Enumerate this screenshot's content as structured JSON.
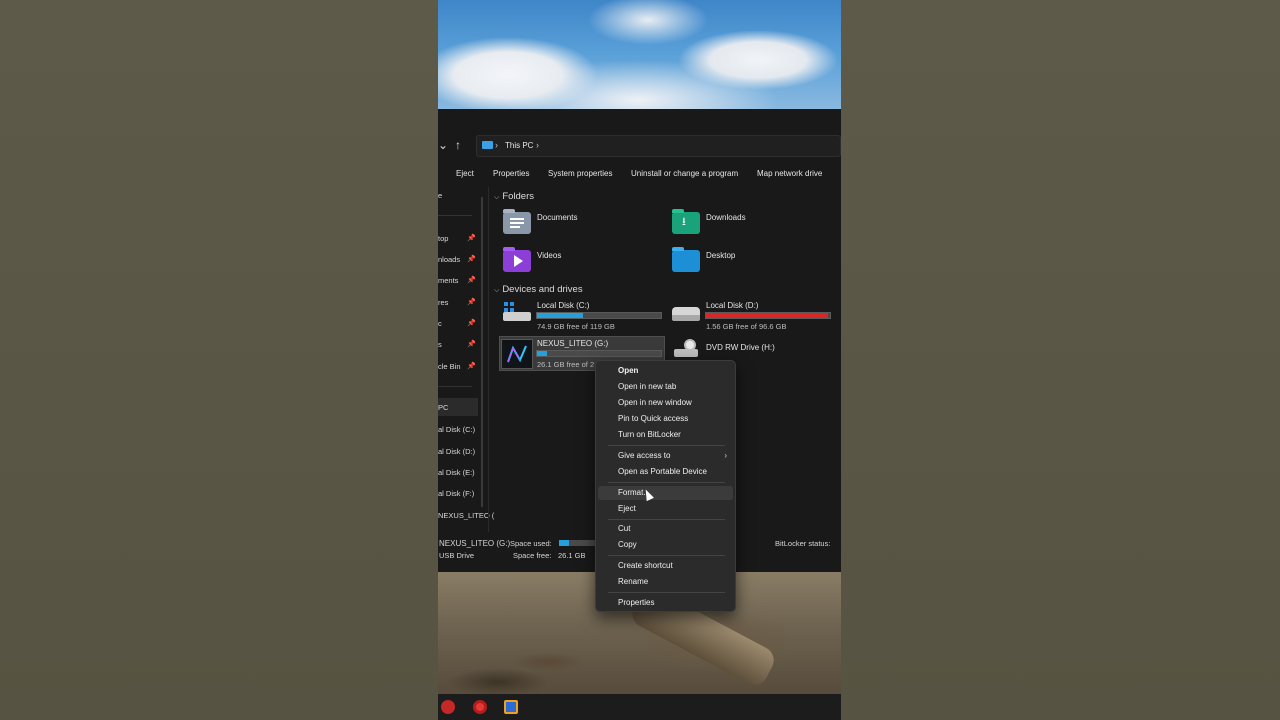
{
  "address": {
    "location": "This PC"
  },
  "toolbar": {
    "eject": "Eject",
    "properties": "Properties",
    "system_properties": "System properties",
    "uninstall": "Uninstall or change a program",
    "map_drive": "Map network drive"
  },
  "sidebar": {
    "top_fragment": "e",
    "items": [
      {
        "label": "top",
        "pinned": true
      },
      {
        "label": "nloads",
        "pinned": true
      },
      {
        "label": "ments",
        "pinned": true
      },
      {
        "label": "res",
        "pinned": true
      },
      {
        "label": "c",
        "pinned": true
      },
      {
        "label": "s",
        "pinned": true
      },
      {
        "label": "cle Bin",
        "pinned": true
      }
    ],
    "this_pc": "PC",
    "drives": [
      "al Disk (C:)",
      "al Disk (D:)",
      "al Disk (E:)",
      "al Disk (F:)",
      "NEXUS_LITEO ("
    ]
  },
  "sections": {
    "folders_title": "Folders",
    "devices_title": "Devices and drives"
  },
  "folders": [
    {
      "name": "Documents",
      "icon": "documents-folder-icon"
    },
    {
      "name": "Downloads",
      "icon": "downloads-folder-icon"
    },
    {
      "name": "Videos",
      "icon": "videos-folder-icon"
    },
    {
      "name": "Desktop",
      "icon": "desktop-folder-icon"
    }
  ],
  "drives": [
    {
      "name": "Local Disk (C:)",
      "free": "74.9 GB free of 119 GB",
      "used_fraction": 0.37,
      "bar_color": "#26a0da"
    },
    {
      "name": "Local Disk (D:)",
      "free": "1.56 GB free of 96.6 GB",
      "used_fraction": 0.98,
      "bar_color": "#da2626"
    },
    {
      "name": "NEXUS_LITEO (G:)",
      "free": "26.1 GB free of 2",
      "used_fraction": 0.08,
      "bar_color": "#26a0da"
    },
    {
      "name": "DVD RW Drive (H:)",
      "free": "",
      "used_fraction": null,
      "bar_color": ""
    }
  ],
  "details": {
    "drive_name": "NEXUS_LITEO (G:)",
    "drive_type": "USB Drive",
    "space_used_label": "Space used:",
    "space_free_label": "Space free:",
    "space_free_value": "26.1 GB",
    "bitlocker_label": "BitLocker status:"
  },
  "context_menu": {
    "open": "Open",
    "open_new_tab": "Open in new tab",
    "open_new_window": "Open in new window",
    "pin_quick_access": "Pin to Quick access",
    "bitlocker": "Turn on BitLocker",
    "give_access": "Give access to",
    "portable_device": "Open as Portable Device",
    "format": "Format...",
    "eject": "Eject",
    "cut": "Cut",
    "copy": "Copy",
    "create_shortcut": "Create shortcut",
    "rename": "Rename",
    "properties": "Properties"
  }
}
